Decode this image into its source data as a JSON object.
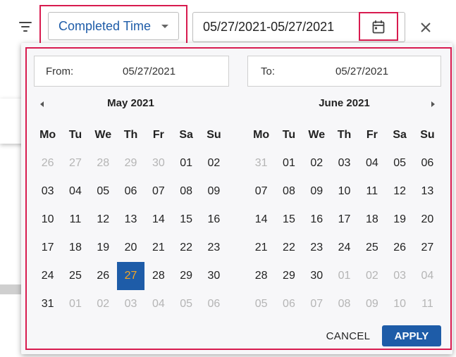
{
  "toolbar": {
    "filter_icon": "filter-list-icon",
    "field_select": {
      "selected": "Completed Time"
    },
    "date_range": {
      "value": "05/27/2021-05/27/2021"
    },
    "calendar_icon": "calendar-icon",
    "close_icon": "close-icon"
  },
  "picker": {
    "from": {
      "label": "From:",
      "value": "05/27/2021"
    },
    "to": {
      "label": "To:",
      "value": "05/27/2021"
    },
    "weekdays": [
      "Mo",
      "Tu",
      "We",
      "Th",
      "Fr",
      "Sa",
      "Su"
    ],
    "months": [
      {
        "title": "May 2021",
        "days": [
          {
            "t": "26",
            "m": true
          },
          {
            "t": "27",
            "m": true
          },
          {
            "t": "28",
            "m": true
          },
          {
            "t": "29",
            "m": true
          },
          {
            "t": "30",
            "m": true
          },
          {
            "t": "01"
          },
          {
            "t": "02"
          },
          {
            "t": "03"
          },
          {
            "t": "04"
          },
          {
            "t": "05"
          },
          {
            "t": "06"
          },
          {
            "t": "07"
          },
          {
            "t": "08"
          },
          {
            "t": "09"
          },
          {
            "t": "10"
          },
          {
            "t": "11"
          },
          {
            "t": "12"
          },
          {
            "t": "13"
          },
          {
            "t": "14"
          },
          {
            "t": "15"
          },
          {
            "t": "16"
          },
          {
            "t": "17"
          },
          {
            "t": "18"
          },
          {
            "t": "19"
          },
          {
            "t": "20"
          },
          {
            "t": "21"
          },
          {
            "t": "22"
          },
          {
            "t": "23"
          },
          {
            "t": "24"
          },
          {
            "t": "25"
          },
          {
            "t": "26"
          },
          {
            "t": "27",
            "s": true
          },
          {
            "t": "28"
          },
          {
            "t": "29"
          },
          {
            "t": "30"
          },
          {
            "t": "31"
          },
          {
            "t": "01",
            "m": true
          },
          {
            "t": "02",
            "m": true
          },
          {
            "t": "03",
            "m": true
          },
          {
            "t": "04",
            "m": true
          },
          {
            "t": "05",
            "m": true
          },
          {
            "t": "06",
            "m": true
          }
        ]
      },
      {
        "title": "June 2021",
        "days": [
          {
            "t": "31",
            "m": true
          },
          {
            "t": "01"
          },
          {
            "t": "02"
          },
          {
            "t": "03"
          },
          {
            "t": "04"
          },
          {
            "t": "05"
          },
          {
            "t": "06"
          },
          {
            "t": "07"
          },
          {
            "t": "08"
          },
          {
            "t": "09"
          },
          {
            "t": "10"
          },
          {
            "t": "11"
          },
          {
            "t": "12"
          },
          {
            "t": "13"
          },
          {
            "t": "14"
          },
          {
            "t": "15"
          },
          {
            "t": "16"
          },
          {
            "t": "17"
          },
          {
            "t": "18"
          },
          {
            "t": "19"
          },
          {
            "t": "20"
          },
          {
            "t": "21"
          },
          {
            "t": "22"
          },
          {
            "t": "23"
          },
          {
            "t": "24"
          },
          {
            "t": "25"
          },
          {
            "t": "26"
          },
          {
            "t": "27"
          },
          {
            "t": "28"
          },
          {
            "t": "29"
          },
          {
            "t": "30"
          },
          {
            "t": "01",
            "m": true
          },
          {
            "t": "02",
            "m": true
          },
          {
            "t": "03",
            "m": true
          },
          {
            "t": "04",
            "m": true
          },
          {
            "t": "05",
            "m": true
          },
          {
            "t": "06",
            "m": true
          },
          {
            "t": "07",
            "m": true
          },
          {
            "t": "08",
            "m": true
          },
          {
            "t": "09",
            "m": true
          },
          {
            "t": "10",
            "m": true
          },
          {
            "t": "11",
            "m": true
          }
        ]
      }
    ],
    "cancel_label": "CANCEL",
    "apply_label": "APPLY"
  },
  "colors": {
    "accent": "#1e5ca8",
    "highlight_frame": "#d81b4f",
    "selected_text": "#f5a623"
  }
}
